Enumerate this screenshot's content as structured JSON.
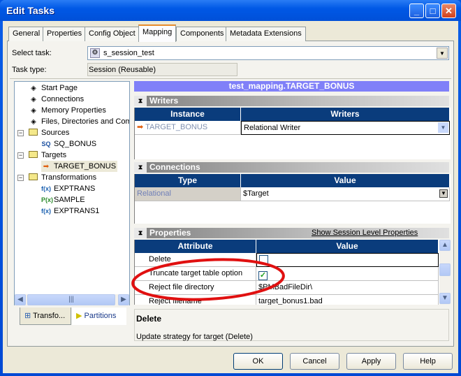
{
  "window": {
    "title": "Edit Tasks",
    "controls": [
      "minimize",
      "maximize",
      "close"
    ]
  },
  "tabs": [
    {
      "label": "General"
    },
    {
      "label": "Properties"
    },
    {
      "label": "Config Object"
    },
    {
      "label": "Mapping",
      "active": true
    },
    {
      "label": "Components"
    },
    {
      "label": "Metadata Extensions"
    }
  ],
  "select_task": {
    "label": "Select task:",
    "value": "s_session_test"
  },
  "task_type": {
    "label": "Task type:",
    "value": "Session (Reusable)"
  },
  "tree": {
    "items": [
      "Start Page",
      "Connections",
      "Memory Properties",
      "Files, Directories and Commands"
    ],
    "sources": {
      "label": "Sources",
      "children": [
        "SQ_BONUS"
      ]
    },
    "targets": {
      "label": "Targets",
      "children": [
        "TARGET_BONUS"
      ]
    },
    "transformations": {
      "label": "Transformations",
      "children": [
        "EXPTRANS",
        "SAMPLE",
        "EXPTRANS1"
      ]
    }
  },
  "bottom_tabs": [
    {
      "label": "Transfo..."
    },
    {
      "label": "Partitions"
    }
  ],
  "mapping_title": "test_mapping.TARGET_BONUS",
  "writers": {
    "title": "Writers",
    "columns": [
      "Instance",
      "Writers"
    ],
    "rows": [
      {
        "instance": "TARGET_BONUS",
        "writer": "Relational Writer"
      }
    ]
  },
  "connections": {
    "title": "Connections",
    "columns": [
      "Type",
      "Value"
    ],
    "rows": [
      {
        "type": "Relational",
        "value": "$Target"
      }
    ]
  },
  "properties": {
    "title": "Properties",
    "link": "Show Session Level Properties",
    "columns": [
      "Attribute",
      "Value"
    ],
    "rows": [
      {
        "attribute": "Delete",
        "value": "",
        "checked": false
      },
      {
        "attribute": "Truncate target table option",
        "value": "",
        "checked": true
      },
      {
        "attribute": "Reject file directory",
        "value": "$PMBadFileDir\\"
      },
      {
        "attribute": "Reject filename",
        "value": "target_bonus1.bad"
      }
    ]
  },
  "description": {
    "title": "Delete",
    "text": "Update strategy for target (Delete)"
  },
  "buttons": {
    "ok": "OK",
    "cancel": "Cancel",
    "apply": "Apply",
    "help": "Help"
  },
  "annotation_color": "#e01010"
}
